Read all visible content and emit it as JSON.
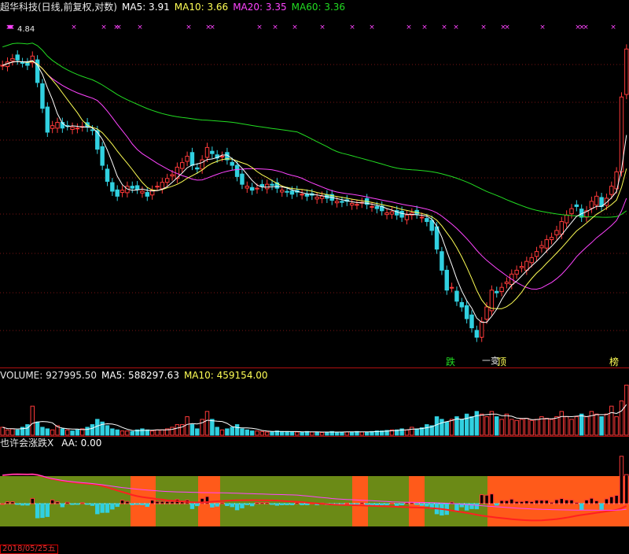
{
  "header": {
    "title": "超华科技(日线,前复权,对数)",
    "ma5": "MA5: 3.91",
    "ma10": "MA10: 3.66",
    "ma20": "MA20: 3.35",
    "ma60": "MA60: 3.36"
  },
  "volume_header": {
    "label": "VOLUME: 927995.50",
    "ma5": "MA5: 588297.63",
    "ma10": "MA10: 459154.00"
  },
  "indicator_header": {
    "name": "也许会涨跌X",
    "aa": "AA: 0.00"
  },
  "signals": {
    "die": "跌",
    "bian": "一变",
    "ding": "顶",
    "bang": "榜"
  },
  "corner_price": "4.84",
  "date_label": "2018/05/25五",
  "colors": {
    "up": "#ff3a3a",
    "down": "#31d0e0",
    "ma5": "#ffffff",
    "ma10": "#ffff55",
    "ma20": "#ff44ff",
    "ma60": "#22dd22",
    "bull_zone": "#ff5a1a",
    "bear_zone": "#6b8a16"
  },
  "chart_data": [
    {
      "type": "candlestick",
      "title": "超华科技(日线,前复权,对数)",
      "y_scale": "log",
      "ylim": [
        2.15,
        5.3
      ],
      "closes": [
        4.7,
        4.75,
        4.8,
        4.78,
        4.74,
        4.7,
        4.84,
        4.45,
        4.1,
        3.8,
        3.88,
        3.92,
        3.85,
        3.88,
        3.86,
        3.85,
        3.87,
        3.86,
        3.82,
        3.6,
        3.42,
        3.25,
        3.15,
        3.1,
        3.16,
        3.2,
        3.18,
        3.17,
        3.15,
        3.1,
        3.16,
        3.2,
        3.24,
        3.28,
        3.32,
        3.4,
        3.45,
        3.52,
        3.42,
        3.38,
        3.48,
        3.62,
        3.55,
        3.5,
        3.52,
        3.48,
        3.42,
        3.3,
        3.22,
        3.2,
        3.16,
        3.18,
        3.2,
        3.22,
        3.21,
        3.18,
        3.16,
        3.14,
        3.12,
        3.14,
        3.12,
        3.1,
        3.11,
        3.09,
        3.1,
        3.08,
        3.06,
        3.05,
        3.04,
        3.05,
        3.03,
        3.02,
        3.04,
        3.02,
        3.0,
        2.98,
        2.96,
        2.94,
        2.95,
        2.92,
        2.9,
        2.92,
        2.94,
        2.93,
        2.9,
        2.86,
        2.78,
        2.62,
        2.45,
        2.3,
        2.32,
        2.22,
        2.18,
        2.1,
        2.04,
        1.98,
        2.08,
        2.18,
        2.3,
        2.28,
        2.32,
        2.36,
        2.42,
        2.45,
        2.48,
        2.52,
        2.55,
        2.6,
        2.65,
        2.7,
        2.72,
        2.78,
        2.86,
        2.92,
        2.98,
        3.0,
        2.9,
        2.96,
        3.05,
        3.1,
        3.0,
        3.08,
        3.2,
        3.35,
        4.25,
        4.95
      ],
      "ma60_last": 3.36,
      "ma20_last": 3.35,
      "ma10_last": 3.66,
      "ma5_last": 3.91
    },
    {
      "type": "bar",
      "title": "VOLUME",
      "values_relative": [
        0.15,
        0.1,
        0.12,
        0.1,
        0.15,
        0.2,
        0.55,
        0.25,
        0.15,
        0.12,
        0.1,
        0.18,
        0.12,
        0.1,
        0.08,
        0.1,
        0.12,
        0.15,
        0.2,
        0.3,
        0.25,
        0.18,
        0.12,
        0.1,
        0.08,
        0.08,
        0.07,
        0.1,
        0.12,
        0.1,
        0.08,
        0.1,
        0.1,
        0.12,
        0.15,
        0.2,
        0.2,
        0.35,
        0.2,
        0.12,
        0.3,
        0.45,
        0.3,
        0.15,
        0.1,
        0.12,
        0.15,
        0.2,
        0.12,
        0.1,
        0.08,
        0.08,
        0.07,
        0.06,
        0.06,
        0.08,
        0.07,
        0.07,
        0.06,
        0.06,
        0.06,
        0.07,
        0.06,
        0.06,
        0.05,
        0.06,
        0.07,
        0.06,
        0.06,
        0.06,
        0.06,
        0.07,
        0.06,
        0.06,
        0.07,
        0.08,
        0.08,
        0.09,
        0.1,
        0.1,
        0.12,
        0.1,
        0.15,
        0.12,
        0.14,
        0.2,
        0.18,
        0.35,
        0.3,
        0.25,
        0.3,
        0.35,
        0.3,
        0.4,
        0.35,
        0.45,
        0.4,
        0.35,
        0.45,
        0.35,
        0.3,
        0.4,
        0.3,
        0.28,
        0.3,
        0.32,
        0.28,
        0.3,
        0.35,
        0.32,
        0.3,
        0.35,
        0.45,
        0.35,
        0.3,
        0.35,
        0.4,
        0.35,
        0.45,
        0.4,
        0.35,
        0.4,
        0.55,
        0.35,
        0.65,
        0.95
      ],
      "ma5_last": 588297.63,
      "ma10_last": 459154.0,
      "last": 927995.5
    },
    {
      "type": "indicator",
      "title": "也许会涨跌X",
      "AA": 0.0,
      "zones": [
        "bear",
        "bull",
        "bear",
        "bull",
        "bear",
        "bull",
        "bear",
        "bull",
        "bear",
        "bull"
      ]
    }
  ]
}
